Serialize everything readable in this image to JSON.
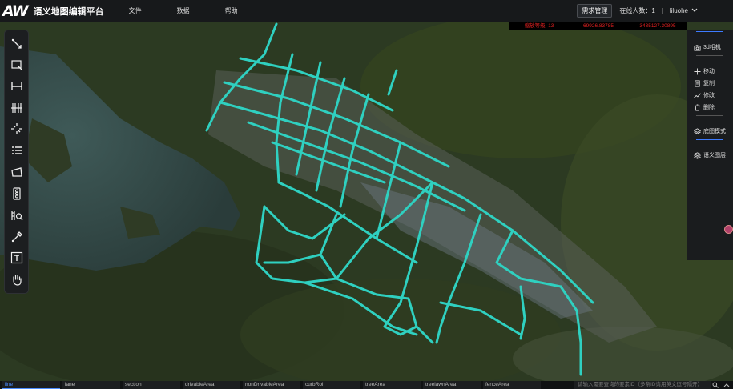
{
  "app": {
    "logo": "AW",
    "title": "语义地图编辑平台"
  },
  "menu": [
    "文件",
    "数据",
    "帮助"
  ],
  "header": {
    "request_button": "需求管理",
    "online_label": "在线人数：1",
    "separator": "|",
    "username": "liluohe"
  },
  "status": {
    "zoom": "缩放等级: 13",
    "x": "69926.83785",
    "y": "3435127.30895"
  },
  "right_panel": {
    "camera": "3d相机",
    "move": "移动",
    "copy": "复制",
    "edit": "修改",
    "delete": "删除",
    "basemap": "底图模式",
    "semantic_layers": "语义图层"
  },
  "toolbar_icons": [
    "draw-line-icon",
    "rectangle-select-icon",
    "horizontal-measure-icon",
    "lane-divider-icon",
    "split-icon",
    "list-icon",
    "polygon-icon",
    "traffic-light-icon",
    "ruler-search-icon",
    "eyedropper-icon",
    "text-icon",
    "hand-pan-icon"
  ],
  "bottom_tabs": [
    "line",
    "lane",
    "section",
    "drivableArea",
    "nonDrivableArea",
    "curbRoi",
    "treeArea",
    "treelawnArea",
    "fenceArea"
  ],
  "active_tab": "line",
  "search": {
    "placeholder": "请输入需要查询的要素ID（多条ID请用英文逗号隔开）"
  },
  "colors": {
    "road": "#2fd0c0",
    "accent": "#3d7bff",
    "status_text": "#e02020"
  }
}
